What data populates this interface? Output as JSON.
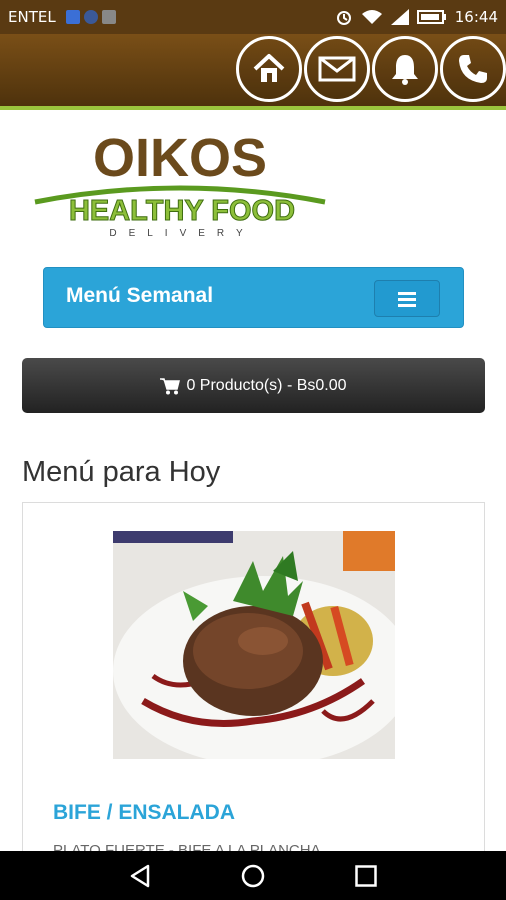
{
  "status_bar": {
    "carrier": "ENTEL",
    "time": "16:44"
  },
  "header": {
    "buttons": [
      {
        "name": "home",
        "icon": "home-icon"
      },
      {
        "name": "mail",
        "icon": "envelope-icon"
      },
      {
        "name": "alerts",
        "icon": "bell-icon"
      },
      {
        "name": "phone",
        "icon": "phone-icon"
      }
    ],
    "colors": {
      "bg": "#5a3a12",
      "accent": "#9bc53d"
    }
  },
  "logo": {
    "brand": "OIKOS",
    "tagline": "HEALTHY FOOD",
    "subtitle": "DELIVERY"
  },
  "nav": {
    "title": "Menú Semanal",
    "toggle_icon": "hamburger-icon",
    "color": "#2ba4d8"
  },
  "cart": {
    "label": "0 Producto(s) - Bs0.00",
    "icon": "cart-icon"
  },
  "main": {
    "section_title": "Menú para Hoy",
    "item": {
      "title": "BIFE / ENSALADA",
      "description": "PLATO FUERTE - BIFE A LA PLANCHA"
    }
  },
  "system_nav": {
    "icons": [
      "back-icon",
      "home-circle-icon",
      "recents-icon"
    ]
  }
}
